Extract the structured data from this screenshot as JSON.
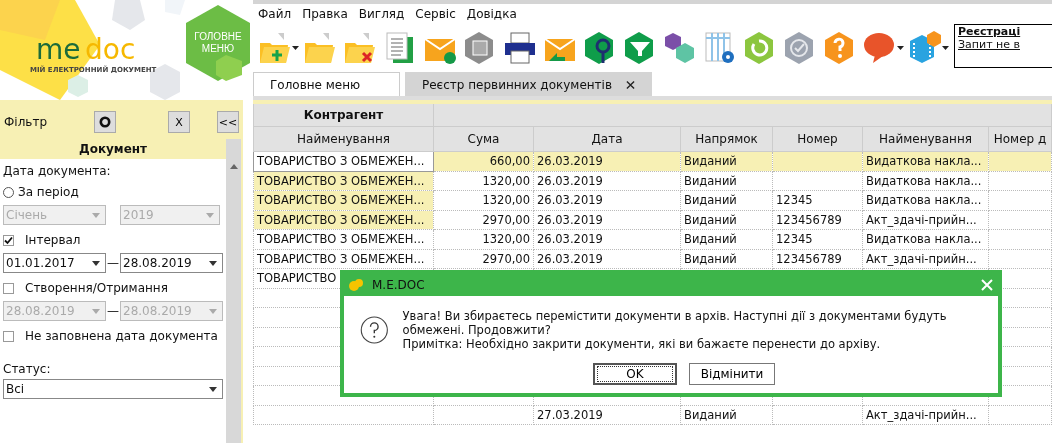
{
  "logo": {
    "me": "me",
    "doc": "doc",
    "tagline": "МІЙ ЕЛЕКТРОННИЙ ДОКУМЕНТ"
  },
  "main_menu_button": "ГОЛОВНЕ МЕНЮ",
  "menu": [
    "Файл",
    "Правка",
    "Вигляд",
    "Сервіс",
    "Довідка"
  ],
  "registration": {
    "title": "Реєстраці",
    "link": "Запит не в"
  },
  "tabs": [
    {
      "label": "Головне меню",
      "selected": false,
      "closable": false
    },
    {
      "label": "Реєстр первинних документів",
      "selected": true,
      "closable": true
    }
  ],
  "filter": {
    "title": "Фільтр",
    "close_label": "X",
    "collapse_label": "<<",
    "section": "Документ",
    "date_label": "Дата документа:",
    "period": {
      "label": "За період",
      "selected": false,
      "month": "Січень",
      "year": "2019"
    },
    "interval": {
      "label": "Інтервал",
      "checked": true,
      "from": "01.01.2017",
      "to": "28.08.2019",
      "separator": "—"
    },
    "created": {
      "label": "Створення/Отримання",
      "checked": false,
      "from": "28.08.2019",
      "to": "28.08.2019",
      "separator": "—"
    },
    "no_date": {
      "label": "Не заповнена дата документа",
      "checked": false
    },
    "status": {
      "label": "Статус:",
      "value": "Всі"
    }
  },
  "table": {
    "group_header": "Контрагент",
    "columns": [
      {
        "label": "Найменування"
      },
      {
        "label": "Сума"
      },
      {
        "label": "Дата"
      },
      {
        "label": "Напрямок"
      },
      {
        "label": "Номер"
      },
      {
        "label": "Найменування"
      },
      {
        "label": "Номер д"
      }
    ],
    "rows": [
      {
        "selected": true,
        "marked": false,
        "contractor": "ТОВАРИСТВО З ОБМЕЖЕН...",
        "sum": "660,00",
        "date": "26.03.2019",
        "direction": "Виданий",
        "doc_name": "Видаткова накла..."
      },
      {
        "selected": false,
        "marked": true,
        "contractor": "ТОВАРИСТВО З ОБМЕЖЕН...",
        "sum": "1320,00",
        "date": "26.03.2019",
        "direction": "Виданий",
        "doc_name": "Видаткова накла..."
      },
      {
        "selected": false,
        "marked": true,
        "contractor": "ТОВАРИСТВО З ОБМЕЖЕН...",
        "sum": "1320,00",
        "date": "26.03.2019",
        "direction": "Виданий",
        "number": "12345",
        "doc_name": "Видаткова накла..."
      },
      {
        "selected": false,
        "marked": true,
        "contractor": "ТОВАРИСТВО З ОБМЕЖЕН...",
        "sum": "2970,00",
        "date": "26.03.2019",
        "direction": "Виданий",
        "number": "123456789",
        "doc_name": "Акт_здачі-прийн..."
      },
      {
        "selected": false,
        "marked": false,
        "contractor": "ТОВАРИСТВО З ОБМЕЖЕН...",
        "sum": "1320,00",
        "date": "26.03.2019",
        "direction": "Виданий",
        "number": "12345",
        "doc_name": "Видаткова накла..."
      },
      {
        "selected": false,
        "marked": false,
        "contractor": "ТОВАРИСТВО З ОБМЕЖЕН...",
        "sum": "2970,00",
        "date": "26.03.2019",
        "direction": "Виданий",
        "number": "123456789",
        "doc_name": "Акт_здачі-прийн..."
      },
      {
        "selected": false,
        "marked": false,
        "contractor": "ТОВАРИСТВО"
      },
      {
        "selected": false,
        "marked": false
      },
      {
        "selected": false,
        "marked": false
      },
      {
        "selected": false,
        "marked": false
      },
      {
        "selected": false,
        "marked": false
      },
      {
        "selected": false,
        "marked": false
      },
      {
        "selected": false,
        "marked": false
      },
      {
        "selected": false,
        "marked": false,
        "date": "27.03.2019",
        "direction": "Виданий",
        "doc_name": "Акт_здачі-прийн..."
      }
    ]
  },
  "dialog": {
    "title": "M.E.DOC",
    "message": "Увага! Ви збираєтесь перемістити документи в архів. Наступні дії з документами будуть обмежені. Продовжити?",
    "note": "Примітка: Необхідно закрити документи, які ви бажаєте перенести до архіву.",
    "buttons": [
      {
        "label": "OK",
        "default": true
      },
      {
        "label": "Відмінити",
        "default": false
      }
    ]
  }
}
